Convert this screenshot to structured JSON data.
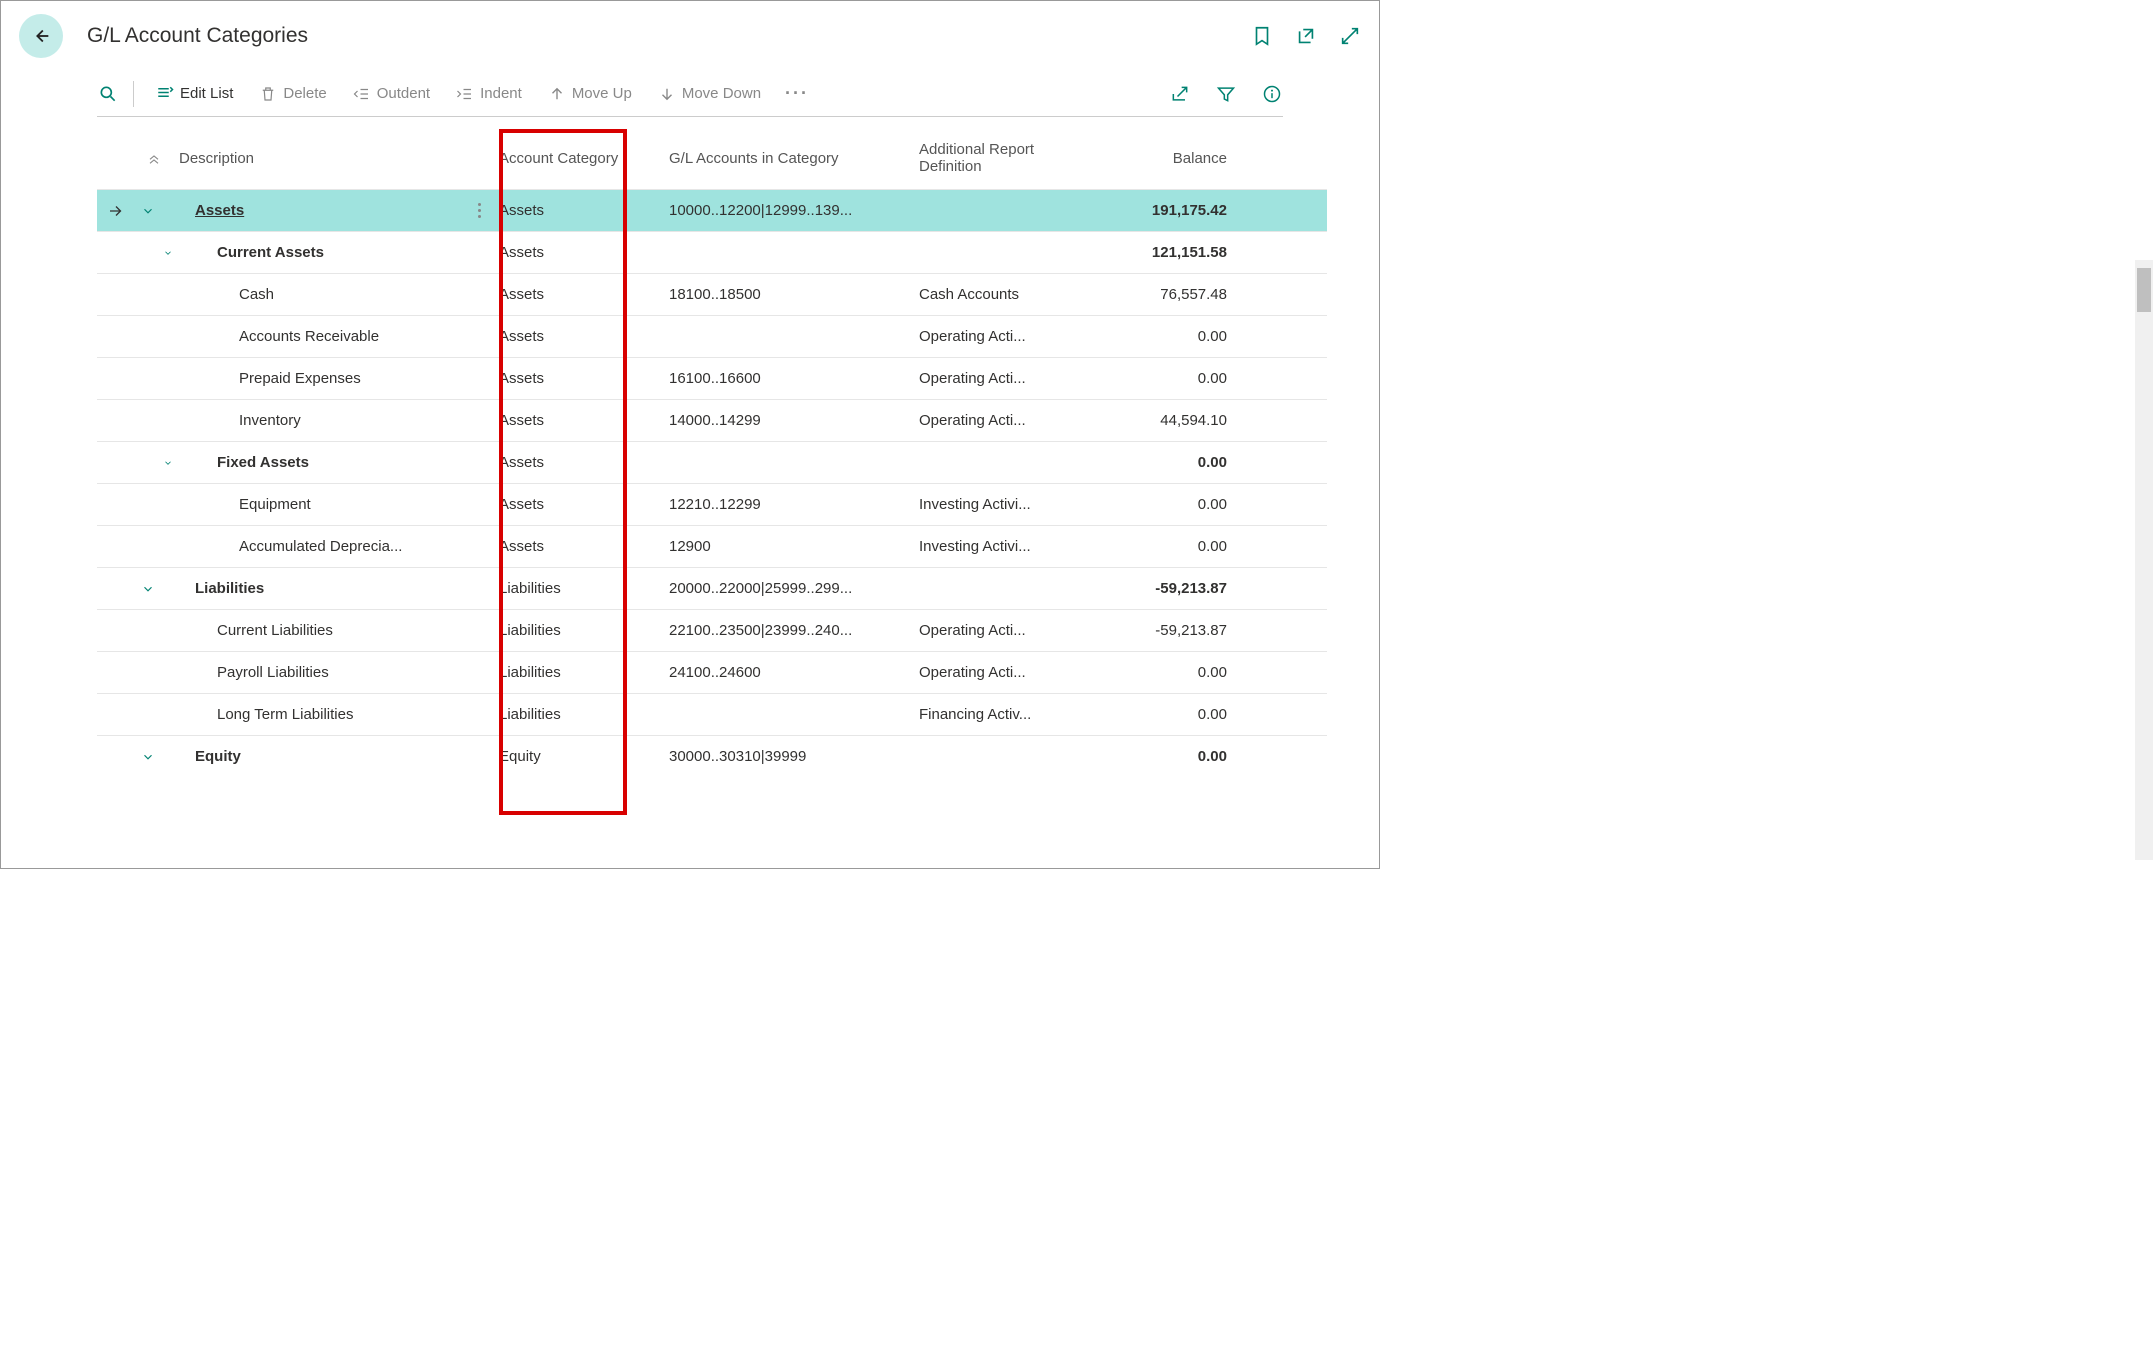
{
  "title": "G/L Account Categories",
  "toolbar": {
    "editList": "Edit List",
    "delete": "Delete",
    "outdent": "Outdent",
    "indent": "Indent",
    "moveUp": "Move Up",
    "moveDown": "Move Down"
  },
  "columns": {
    "description": "Description",
    "accountCategory": "Account Category",
    "glAccounts": "G/L Accounts in Category",
    "additionalReport": "Additional Report Definition",
    "balance": "Balance"
  },
  "rows": [
    {
      "indent": 0,
      "chev": "down",
      "desc": "Assets",
      "bold": true,
      "under": true,
      "selected": true,
      "menu": true,
      "cat": "Assets",
      "gl": "10000..12200|12999..139...",
      "rep": "",
      "bal": "191,175.42",
      "arrow": true
    },
    {
      "indent": 1,
      "chev": "down",
      "desc": "Current Assets",
      "bold": true,
      "cat": "Assets",
      "gl": "",
      "rep": "",
      "bal": "121,151.58"
    },
    {
      "indent": 2,
      "chev": "",
      "desc": "Cash",
      "cat": "Assets",
      "gl": "18100..18500",
      "rep": "Cash Accounts",
      "bal": "76,557.48"
    },
    {
      "indent": 2,
      "chev": "",
      "desc": "Accounts Receivable",
      "cat": "Assets",
      "gl": "",
      "rep": "Operating Acti...",
      "bal": "0.00"
    },
    {
      "indent": 2,
      "chev": "",
      "desc": "Prepaid Expenses",
      "cat": "Assets",
      "gl": "16100..16600",
      "rep": "Operating Acti...",
      "bal": "0.00"
    },
    {
      "indent": 2,
      "chev": "",
      "desc": "Inventory",
      "cat": "Assets",
      "gl": "14000..14299",
      "rep": "Operating Acti...",
      "bal": "44,594.10"
    },
    {
      "indent": 1,
      "chev": "down",
      "desc": "Fixed Assets",
      "bold": true,
      "cat": "Assets",
      "gl": "",
      "rep": "",
      "bal": "0.00"
    },
    {
      "indent": 2,
      "chev": "",
      "desc": "Equipment",
      "cat": "Assets",
      "gl": "12210..12299",
      "rep": "Investing Activi...",
      "bal": "0.00"
    },
    {
      "indent": 2,
      "chev": "",
      "desc": "Accumulated Deprecia...",
      "cat": "Assets",
      "gl": "12900",
      "rep": "Investing Activi...",
      "bal": "0.00"
    },
    {
      "indent": 0,
      "chev": "down",
      "desc": "Liabilities",
      "bold": true,
      "cat": "Liabilities",
      "gl": "20000..22000|25999..299...",
      "rep": "",
      "bal": "-59,213.87"
    },
    {
      "indent": 1,
      "chev": "",
      "desc": "Current Liabilities",
      "cat": "Liabilities",
      "gl": "22100..23500|23999..240...",
      "rep": "Operating Acti...",
      "bal": "-59,213.87"
    },
    {
      "indent": 1,
      "chev": "",
      "desc": "Payroll Liabilities",
      "cat": "Liabilities",
      "gl": "24100..24600",
      "rep": "Operating Acti...",
      "bal": "0.00"
    },
    {
      "indent": 1,
      "chev": "",
      "desc": "Long Term Liabilities",
      "cat": "Liabilities",
      "gl": "",
      "rep": "Financing Activ...",
      "bal": "0.00"
    },
    {
      "indent": 0,
      "chev": "down",
      "desc": "Equity",
      "bold": true,
      "cat": "Equity",
      "gl": "30000..30310|39999",
      "rep": "",
      "bal": "0.00"
    }
  ]
}
